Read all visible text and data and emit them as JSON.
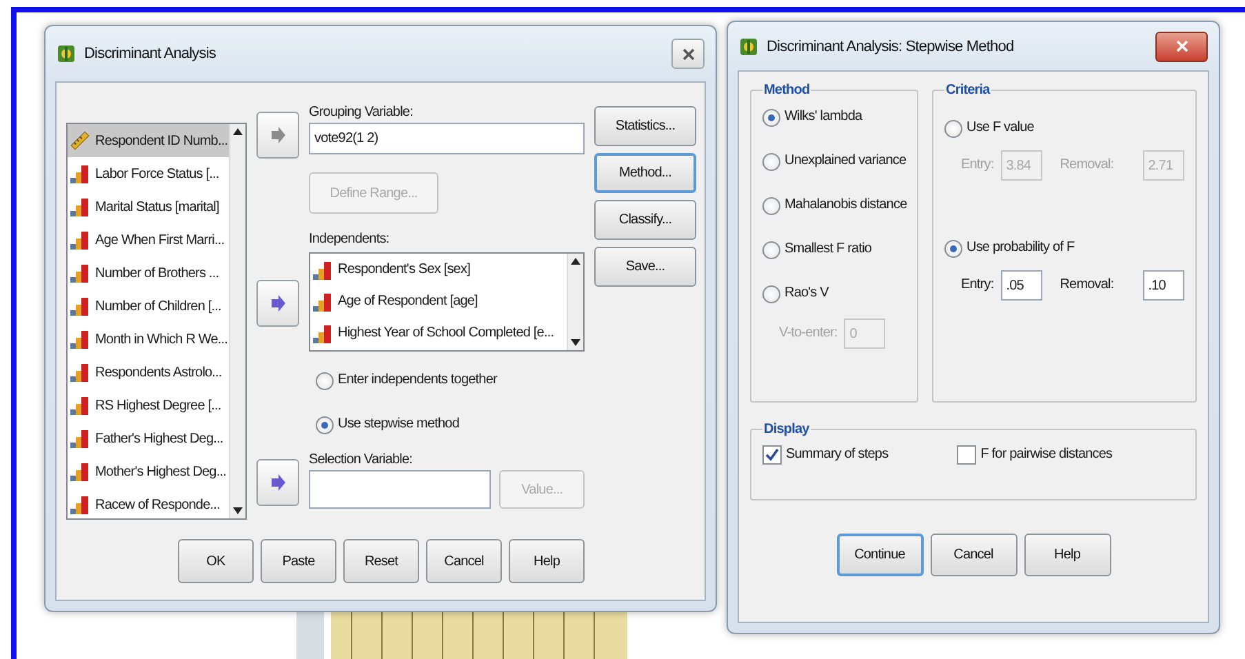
{
  "main_dialog": {
    "title": "Discriminant Analysis",
    "variables": [
      {
        "label": "Respondent ID Numb...",
        "kind": "scale",
        "selected": true
      },
      {
        "label": "Labor Force Status [...",
        "kind": "ordinal",
        "selected": false
      },
      {
        "label": "Marital Status [marital]",
        "kind": "ordinal",
        "selected": false
      },
      {
        "label": "Age When First Marri...",
        "kind": "ordinal",
        "selected": false
      },
      {
        "label": "Number of Brothers ...",
        "kind": "ordinal",
        "selected": false
      },
      {
        "label": "Number of Children [...",
        "kind": "ordinal",
        "selected": false
      },
      {
        "label": "Month in Which R We...",
        "kind": "ordinal",
        "selected": false
      },
      {
        "label": "Respondents Astrolo...",
        "kind": "ordinal",
        "selected": false
      },
      {
        "label": "RS Highest Degree [...",
        "kind": "ordinal",
        "selected": false
      },
      {
        "label": "Father's Highest Deg...",
        "kind": "ordinal",
        "selected": false
      },
      {
        "label": "Mother's Highest Deg...",
        "kind": "ordinal",
        "selected": false
      },
      {
        "label": "Racew of Responde...",
        "kind": "ordinal",
        "selected": false
      }
    ],
    "arrow_buttons": [
      {
        "disabled": true
      },
      {
        "disabled": false
      },
      {
        "disabled": false
      }
    ],
    "grouping_variable": {
      "label": "Grouping Variable:",
      "value": "vote92(1 2)"
    },
    "define_range_button": {
      "label": "Define Range...",
      "disabled": true
    },
    "independents": {
      "label": "Independents:",
      "items": [
        {
          "label": "Respondent's Sex [sex]",
          "kind": "ordinal"
        },
        {
          "label": "Age of Respondent [age]",
          "kind": "ordinal"
        },
        {
          "label": "Highest Year of School Completed [e...",
          "kind": "ordinal"
        }
      ]
    },
    "entry_methods": [
      {
        "label": "Enter independents together",
        "selected": false
      },
      {
        "label": "Use stepwise method",
        "selected": true
      }
    ],
    "selection_variable": {
      "label": "Selection Variable:"
    },
    "value_button": {
      "label": "Value...",
      "disabled": true
    },
    "side_buttons": [
      {
        "label": "Statistics...",
        "focused": false
      },
      {
        "label": "Method...",
        "focused": true
      },
      {
        "label": "Classify...",
        "focused": false
      },
      {
        "label": "Save...",
        "focused": false
      }
    ],
    "bottom_buttons": [
      {
        "label": "OK"
      },
      {
        "label": "Paste"
      },
      {
        "label": "Reset"
      },
      {
        "label": "Cancel"
      },
      {
        "label": "Help"
      }
    ]
  },
  "stepwise_dialog": {
    "title": "Discriminant Analysis: Stepwise Method",
    "method": {
      "label": "Method",
      "options": [
        {
          "label": "Wilks' lambda",
          "selected": true
        },
        {
          "label": "Unexplained variance",
          "selected": false
        },
        {
          "label": "Mahalanobis distance",
          "selected": false
        },
        {
          "label": "Smallest F ratio",
          "selected": false
        },
        {
          "label": "Rao's V",
          "selected": false
        }
      ],
      "v_to_enter": {
        "label": "V-to-enter:",
        "value": "0",
        "disabled": true
      }
    },
    "criteria": {
      "label": "Criteria",
      "options": [
        {
          "label": "Use F value",
          "selected": false,
          "entry": {
            "label": "Entry:",
            "value": "3.84"
          },
          "removal": {
            "label": "Removal:",
            "value": "2.71"
          }
        },
        {
          "label": "Use probability of F",
          "selected": true,
          "entry": {
            "label": "Entry:",
            "value": ".05"
          },
          "removal": {
            "label": "Removal:",
            "value": ".10"
          }
        }
      ]
    },
    "display": {
      "label": "Display",
      "options": [
        {
          "label": "Summary of steps",
          "checked": true
        },
        {
          "label": "F for pairwise distances",
          "checked": false
        }
      ]
    },
    "buttons": [
      {
        "label": "Continue",
        "focused": true
      },
      {
        "label": "Cancel",
        "focused": false
      },
      {
        "label": "Help",
        "focused": false
      }
    ]
  }
}
